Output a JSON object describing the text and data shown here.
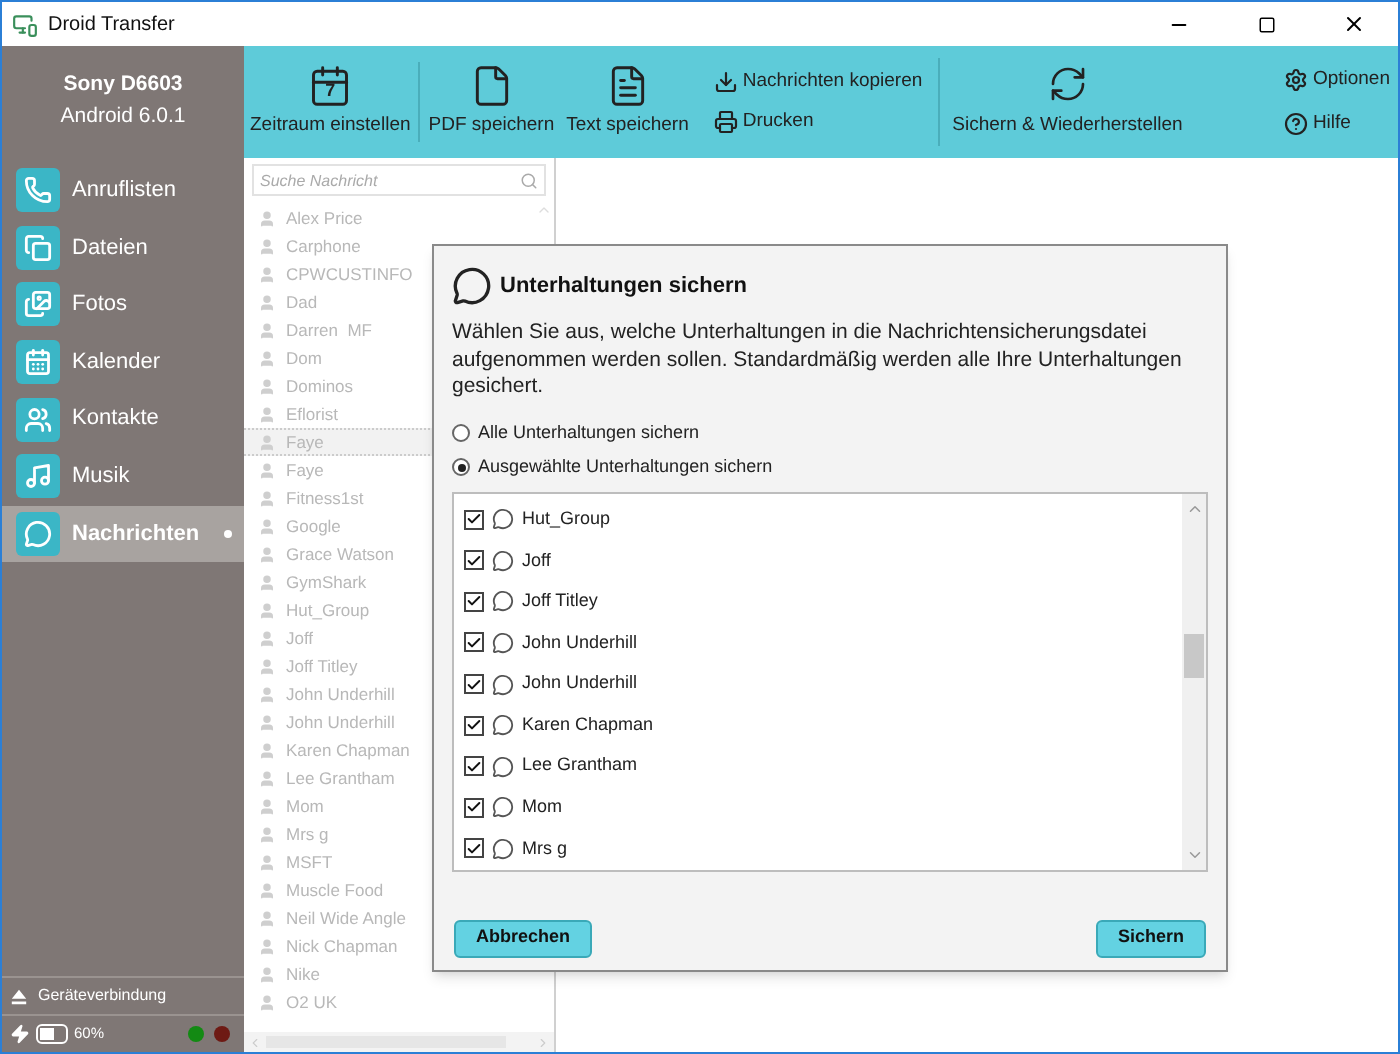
{
  "window": {
    "title": "Droid Transfer"
  },
  "device": {
    "name": "Sony D6603",
    "os": "Android 6.0.1"
  },
  "nav": [
    {
      "label": "Anruflisten",
      "selected": false
    },
    {
      "label": "Dateien",
      "selected": false
    },
    {
      "label": "Fotos",
      "selected": false
    },
    {
      "label": "Kalender",
      "selected": false
    },
    {
      "label": "Kontakte",
      "selected": false
    },
    {
      "label": "Musik",
      "selected": false
    },
    {
      "label": "Nachrichten",
      "selected": true
    }
  ],
  "connection": {
    "label": "Geräteverbindung"
  },
  "battery": {
    "reading": "60%",
    "level": 0.6
  },
  "status_dots": [
    {
      "color": "#138a13"
    },
    {
      "color": "#6e1a14"
    }
  ],
  "toolbar": {
    "large": [
      {
        "label": "Zeitraum einstellen",
        "badge": "7"
      },
      {
        "label": "PDF speichern"
      },
      {
        "label": "Text speichern"
      }
    ],
    "small": [
      {
        "label": "Nachrichten kopieren"
      },
      {
        "label": "Drucken"
      }
    ],
    "backup": {
      "label": "Sichern & Wiederherstellen"
    },
    "right": [
      {
        "label": "Optionen"
      },
      {
        "label": "Hilfe"
      }
    ]
  },
  "search": {
    "placeholder": "Suche Nachricht"
  },
  "contacts": [
    {
      "name": "Alex Price",
      "selected": false
    },
    {
      "name": "Carphone",
      "selected": false
    },
    {
      "name": "CPWCUSTINFO",
      "selected": false
    },
    {
      "name": "Dad",
      "selected": false
    },
    {
      "name": "Darren  MF",
      "selected": false
    },
    {
      "name": "Dom",
      "selected": false
    },
    {
      "name": "Dominos",
      "selected": false
    },
    {
      "name": "Eflorist",
      "selected": false
    },
    {
      "name": "Faye",
      "selected": true
    },
    {
      "name": "Faye",
      "selected": false
    },
    {
      "name": "Fitness1st",
      "selected": false
    },
    {
      "name": "Google",
      "selected": false
    },
    {
      "name": "Grace Watson",
      "selected": false
    },
    {
      "name": "GymShark",
      "selected": false
    },
    {
      "name": "Hut_Group",
      "selected": false
    },
    {
      "name": "Joff",
      "selected": false
    },
    {
      "name": "Joff Titley",
      "selected": false
    },
    {
      "name": "John Underhill",
      "selected": false
    },
    {
      "name": "John Underhill",
      "selected": false
    },
    {
      "name": "Karen Chapman",
      "selected": false
    },
    {
      "name": "Lee Grantham",
      "selected": false
    },
    {
      "name": "Mom",
      "selected": false
    },
    {
      "name": "Mrs g",
      "selected": false
    },
    {
      "name": "MSFT",
      "selected": false
    },
    {
      "name": "Muscle Food",
      "selected": false
    },
    {
      "name": "Neil Wide Angle",
      "selected": false
    },
    {
      "name": "Nick Chapman",
      "selected": false
    },
    {
      "name": "Nike",
      "selected": false
    },
    {
      "name": "O2 UK",
      "selected": false
    }
  ],
  "dialog": {
    "title": "Unterhaltungen sichern",
    "description": "Wählen Sie aus, welche Unterhaltungen in die Nachrichtensicherungsdatei aufgenommen werden sollen. Standardmäßig werden alle Ihre Unterhaltungen gesichert.",
    "options": [
      {
        "label": "Alle Unterhaltungen sichern",
        "selected": false
      },
      {
        "label": "Ausgewählte Unterhaltungen sichern",
        "selected": true
      }
    ],
    "conversations": [
      {
        "name": "Hut_Group",
        "checked": true
      },
      {
        "name": "Joff",
        "checked": true
      },
      {
        "name": "Joff Titley",
        "checked": true
      },
      {
        "name": "John Underhill",
        "checked": true
      },
      {
        "name": "John Underhill",
        "checked": true
      },
      {
        "name": "Karen Chapman",
        "checked": true
      },
      {
        "name": "Lee Grantham",
        "checked": true
      },
      {
        "name": "Mom",
        "checked": true
      },
      {
        "name": "Mrs g",
        "checked": true
      }
    ],
    "buttons": [
      {
        "label": "Abbrechen"
      },
      {
        "label": "Sichern"
      }
    ]
  }
}
